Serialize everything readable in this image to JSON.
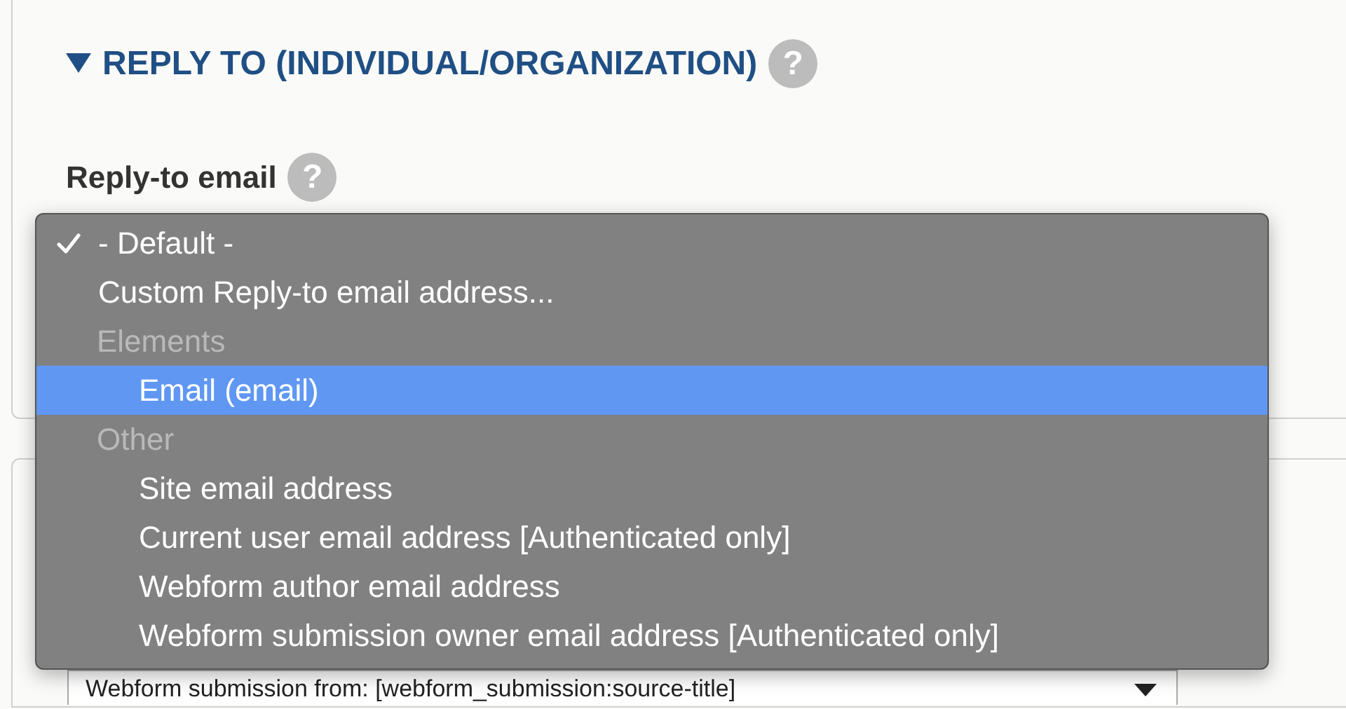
{
  "section": {
    "title": "REPLY TO (INDIVIDUAL/ORGANIZATION)",
    "expanded": true,
    "help": "?"
  },
  "field": {
    "label": "Reply-to email",
    "help": "?"
  },
  "dropdown": {
    "items": [
      {
        "kind": "option",
        "label": "- Default -",
        "checked": true,
        "selected": false
      },
      {
        "kind": "option",
        "label": "Custom Reply-to email address...",
        "checked": false,
        "selected": false
      },
      {
        "kind": "group",
        "label": "Elements",
        "children": [
          {
            "kind": "option",
            "label": "Email (email)",
            "checked": false,
            "selected": true
          }
        ]
      },
      {
        "kind": "group",
        "label": "Other",
        "children": [
          {
            "kind": "option",
            "label": "Site email address",
            "checked": false,
            "selected": false
          },
          {
            "kind": "option",
            "label": "Current user email address [Authenticated only]",
            "checked": false,
            "selected": false
          },
          {
            "kind": "option",
            "label": "Webform author email address",
            "checked": false,
            "selected": false
          },
          {
            "kind": "option",
            "label": "Webform submission owner email address [Authenticated only]",
            "checked": false,
            "selected": false
          }
        ]
      }
    ]
  },
  "next_select": {
    "value": "Webform submission from: [webform_submission:source-title]"
  }
}
